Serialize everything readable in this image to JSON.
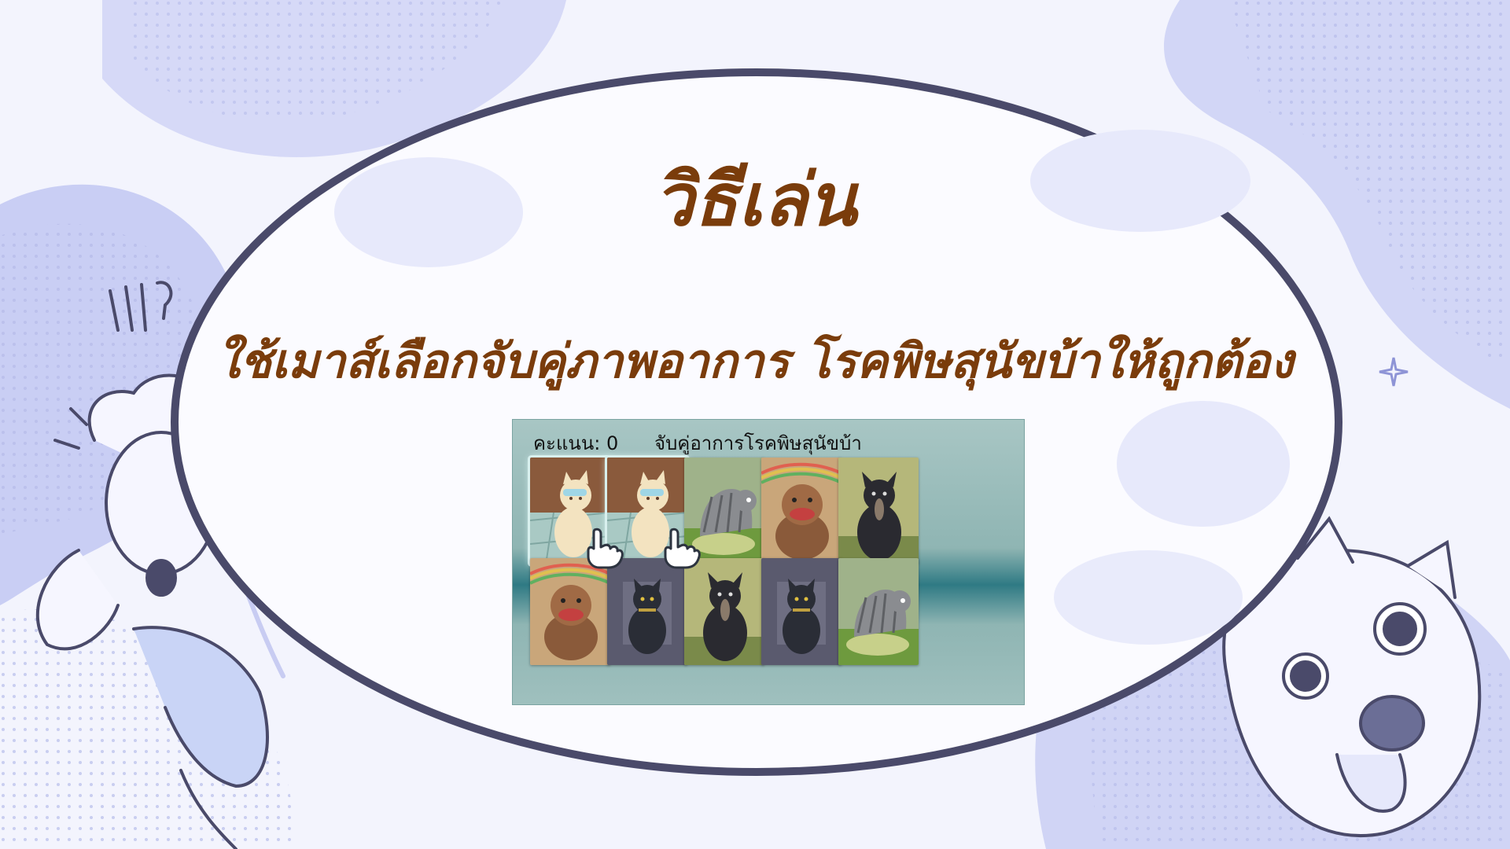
{
  "page": {
    "title": "วิธีเล่น",
    "instruction": "ใช้เมาส์เลือกจับคู่ภาพอาการ โรคพิษสุนัขบ้าให้ถูกต้อง"
  },
  "game_preview": {
    "score_label": "คะแนน: 0",
    "game_title": "จับคู่อาการโรคพิษสุนัขบ้า",
    "cards": [
      {
        "row": 0,
        "col": 0,
        "image": "cream-cat-card",
        "selected": true
      },
      {
        "row": 0,
        "col": 1,
        "image": "cream-cat-card",
        "selected": true
      },
      {
        "row": 0,
        "col": 2,
        "image": "grey-cat-hissing-card",
        "selected": false
      },
      {
        "row": 0,
        "col": 3,
        "image": "angry-bulldog-card",
        "selected": false
      },
      {
        "row": 0,
        "col": 4,
        "image": "black-dog-card",
        "selected": false
      },
      {
        "row": 1,
        "col": 0,
        "image": "angry-bulldog-card",
        "selected": false
      },
      {
        "row": 1,
        "col": 1,
        "image": "black-cat-chair-card",
        "selected": false
      },
      {
        "row": 1,
        "col": 2,
        "image": "black-dog-card",
        "selected": false
      },
      {
        "row": 1,
        "col": 3,
        "image": "black-cat-chair-card",
        "selected": false
      },
      {
        "row": 1,
        "col": 4,
        "image": "grey-cat-hissing-card",
        "selected": false
      }
    ],
    "pointer_icons": [
      "hand-pointer-icon",
      "hand-pointer-icon"
    ]
  },
  "colors": {
    "title": "#7a3c0b",
    "ellipse_border": "#4a4a6a",
    "background": "#eef0fb",
    "blob": "#c8cdf3"
  }
}
